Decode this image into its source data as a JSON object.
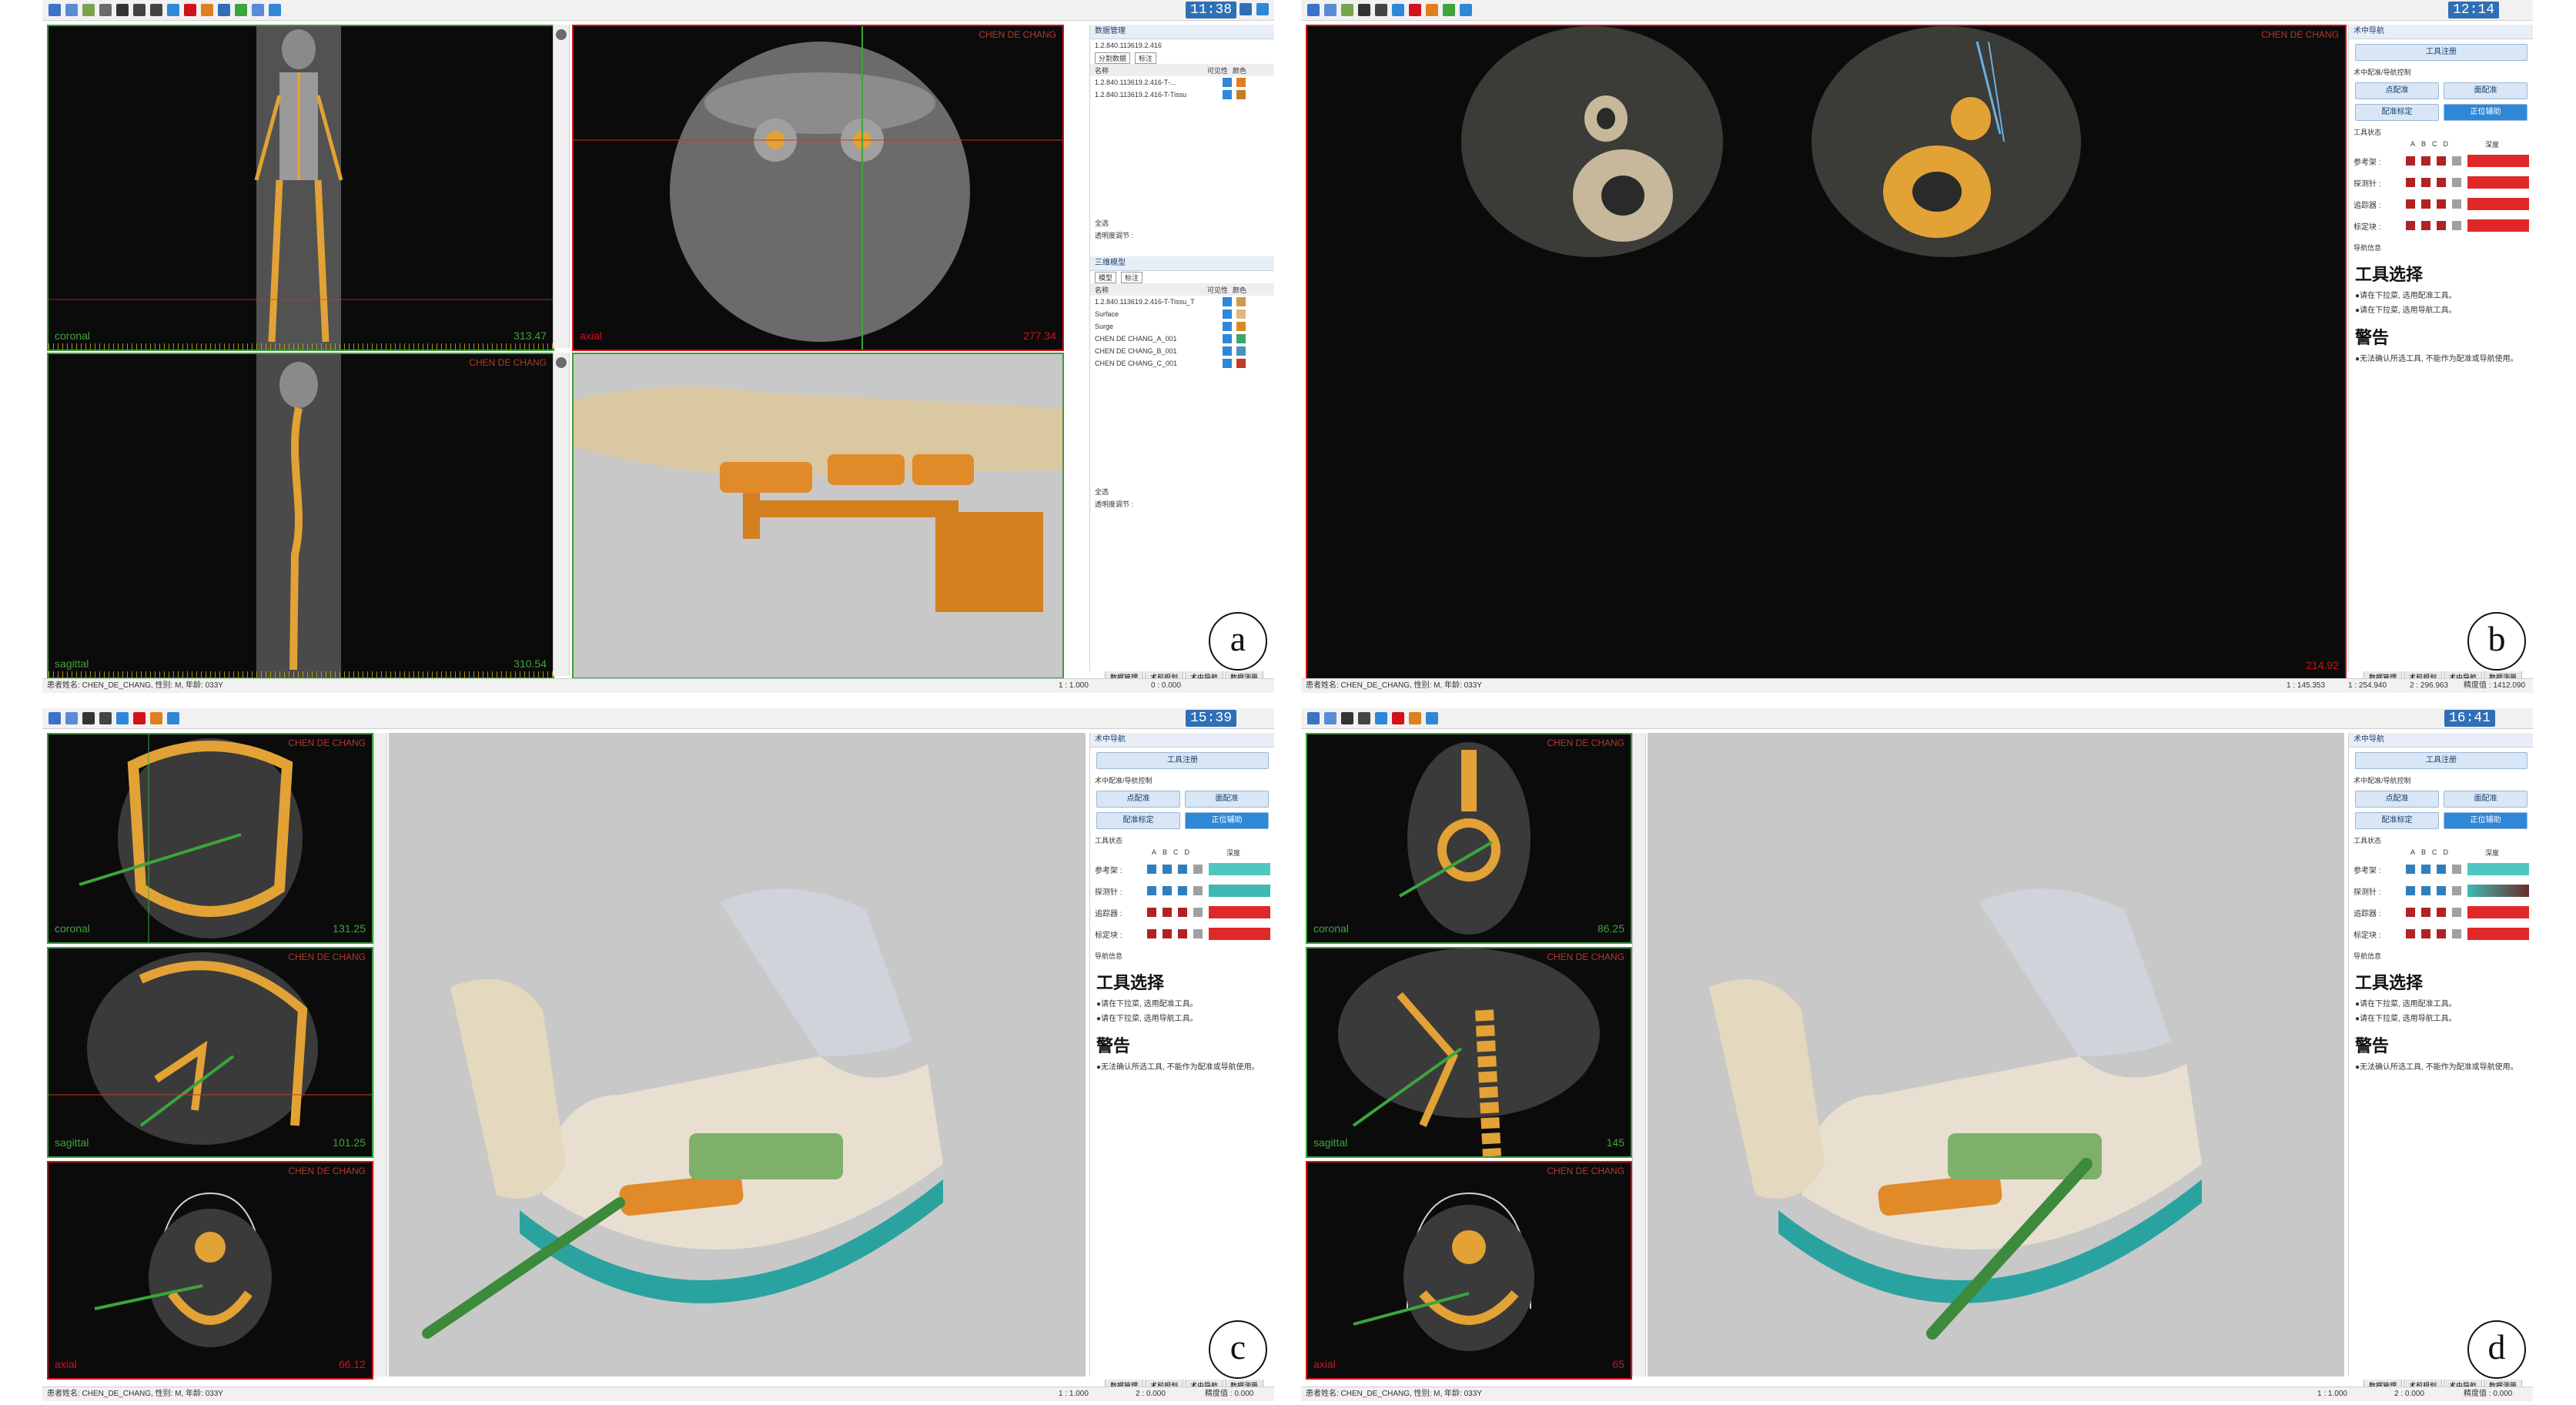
{
  "panels": {
    "a": {
      "letter": "a",
      "clock": "11:38",
      "views": {
        "coronal": {
          "label": "coronal",
          "value": "313.47",
          "name": "CHEN DE CHANG"
        },
        "axial": {
          "label": "axial",
          "value": "277.34",
          "name": "CHEN DE CHANG"
        },
        "sagittal": {
          "label": "sagittal",
          "value": "310.54",
          "name": "CHEN DE CHANG"
        }
      },
      "data_panel": {
        "title": "数据管理",
        "uid": "1.2.840.113619.2.416",
        "tabs": [
          "分割数据",
          "标注"
        ],
        "columns": [
          "名称",
          "可见性",
          "颜色"
        ],
        "rows": [
          {
            "name": "1.2.840.113619.2.416-T-...",
            "color": "#e07f1e"
          },
          {
            "name": "1.2.840.113619.2.416-T-Tissu",
            "color": "#c77b24"
          }
        ],
        "checkbox_all": "全选",
        "opacity_label": "透明度调节 :",
        "models_title": "三维模型",
        "models_tabs": [
          "模型",
          "标注"
        ],
        "models_columns": [
          "名称",
          "可见性",
          "颜色"
        ],
        "models": [
          {
            "name": "1.2.840.113619.2.416-T-Tissu_T",
            "color": "#d19a4a"
          },
          {
            "name": "Surface",
            "color": "#e0b680"
          },
          {
            "name": "Surge",
            "color": "#d88a1e"
          },
          {
            "name": "CHEN DE CHANG_A_001",
            "color": "#3aa66b"
          },
          {
            "name": "CHEN DE CHANG_B_001",
            "color": "#4a90c2"
          },
          {
            "name": "CHEN DE CHANG_C_001",
            "color": "#c0392b"
          }
        ],
        "bottom_checkbox": "全选",
        "bottom_opacity": "透明度调节 :"
      },
      "status": "患者姓名: CHEN_DE_CHANG, 性别: M, 年龄: 033Y",
      "bottom_tabs": [
        "数据管理",
        "术前规划",
        "术中导航",
        "数据测量"
      ],
      "status_right": [
        "1 : 1.000",
        "0 : 0.000"
      ]
    },
    "b": {
      "letter": "b",
      "clock": "12:14",
      "view_value": "214.92",
      "view_name": "CHEN DE CHANG",
      "nav": {
        "title": "术中导航",
        "tool_button": "工具注册",
        "section": "术中配准/导航控制",
        "buttons": [
          "点配准",
          "面配准",
          "配准标定",
          "正位辅助"
        ],
        "tool_status": "工具状态",
        "columns": [
          "A",
          "B",
          "C",
          "D",
          "深度"
        ],
        "rows": [
          {
            "name": "参考架 :",
            "colors": [
              "#b22222",
              "#b22222",
              "#b22222",
              "#a0a0a0"
            ],
            "bar": "#e02828"
          },
          {
            "name": "探测针 :",
            "colors": [
              "#b22222",
              "#b22222",
              "#b22222",
              "#a0a0a0"
            ],
            "bar": "#e02828"
          },
          {
            "name": "追踪器 :",
            "colors": [
              "#b22222",
              "#b22222",
              "#b22222",
              "#a0a0a0"
            ],
            "bar": "#e02828"
          },
          {
            "name": "标定块 :",
            "colors": [
              "#b22222",
              "#b22222",
              "#b22222",
              "#a0a0a0"
            ],
            "bar": "#e02828"
          }
        ],
        "message_title_label": "导航信息",
        "heading1": "工具选择",
        "text1a": "●请在下拉菜, 选用配准工具。",
        "text1b": "●请在下拉菜, 选用导航工具。",
        "heading2": "警告",
        "text2": "●无法确认所选工具, 不能作为配准或导航使用。"
      },
      "status": "患者姓名: CHEN_DE_CHANG, 性别: M, 年龄: 033Y",
      "bottom_tabs": [
        "数据管理",
        "术前规划",
        "术中导航",
        "数据测量"
      ],
      "status_right": [
        "1 : 254.940",
        "2 : 296.963",
        "精度值 : 1412.090",
        "1 : 145.353"
      ]
    },
    "c": {
      "letter": "c",
      "clock": "15:39",
      "views": {
        "coronal": {
          "label": "coronal",
          "value": "131.25",
          "name": "CHEN DE CHANG"
        },
        "sagittal": {
          "label": "sagittal",
          "value": "101.25",
          "name": "CHEN DE CHANG"
        },
        "axial": {
          "label": "axial",
          "value": "66.12",
          "name": "CHEN DE CHANG"
        }
      },
      "nav": {
        "title": "术中导航",
        "tool_button": "工具注册",
        "section": "术中配准/导航控制",
        "buttons": [
          "点配准",
          "面配准",
          "配准标定",
          "正位辅助"
        ],
        "tool_status": "工具状态",
        "columns": [
          "A",
          "B",
          "C",
          "D",
          "深度"
        ],
        "rows": [
          {
            "name": "参考架 :",
            "colors": [
              "#2f7fbf",
              "#2f7fbf",
              "#2f7fbf",
              "#a0a0a0"
            ],
            "bar": "#4fc7c0"
          },
          {
            "name": "探测针 :",
            "colors": [
              "#2f7fbf",
              "#2f7fbf",
              "#2f7fbf",
              "#a0a0a0"
            ],
            "bar": "#3fb8b4"
          },
          {
            "name": "追踪器 :",
            "colors": [
              "#b22222",
              "#b22222",
              "#b22222",
              "#a0a0a0"
            ],
            "bar": "#e02828"
          },
          {
            "name": "标定块 :",
            "colors": [
              "#b22222",
              "#b22222",
              "#b22222",
              "#a0a0a0"
            ],
            "bar": "#e02828"
          }
        ],
        "message_title_label": "导航信息",
        "heading1": "工具选择",
        "text1a": "●请在下拉菜, 选用配准工具。",
        "text1b": "●请在下拉菜, 选用导航工具。",
        "heading2": "警告",
        "text2": "●无法确认所选工具, 不能作为配准或导航使用。"
      },
      "status": "患者姓名: CHEN_DE_CHANG, 性别: M, 年龄: 033Y",
      "bottom_tabs": [
        "数据管理",
        "术前规划",
        "术中导航",
        "数据测量"
      ],
      "status_right": [
        "1 : 1.000",
        "2 : 0.000",
        "精度值 : 0.000"
      ]
    },
    "d": {
      "letter": "d",
      "clock": "16:41",
      "views": {
        "coronal": {
          "label": "coronal",
          "value": "86.25",
          "name": "CHEN DE CHANG"
        },
        "sagittal": {
          "label": "sagittal",
          "value": "145",
          "name": "CHEN DE CHANG"
        },
        "axial": {
          "label": "axial",
          "value": "65",
          "name": "CHEN DE CHANG"
        }
      },
      "nav": {
        "title": "术中导航",
        "tool_button": "工具注册",
        "section": "术中配准/导航控制",
        "buttons": [
          "点配准",
          "面配准",
          "配准标定",
          "正位辅助"
        ],
        "tool_status": "工具状态",
        "columns": [
          "A",
          "B",
          "C",
          "D",
          "深度"
        ],
        "rows": [
          {
            "name": "参考架 :",
            "colors": [
              "#2f7fbf",
              "#2f7fbf",
              "#2f7fbf",
              "#a0a0a0"
            ],
            "bar": "#4fc7c0"
          },
          {
            "name": "探测针 :",
            "colors": [
              "#2f7fbf",
              "#2f7fbf",
              "#2f7fbf",
              "#a0a0a0"
            ],
            "bar": "#6a2c2c"
          },
          {
            "name": "追踪器 :",
            "colors": [
              "#b22222",
              "#b22222",
              "#b22222",
              "#a0a0a0"
            ],
            "bar": "#e02828"
          },
          {
            "name": "标定块 :",
            "colors": [
              "#b22222",
              "#b22222",
              "#b22222",
              "#a0a0a0"
            ],
            "bar": "#e02828"
          }
        ],
        "message_title_label": "导航信息",
        "heading1": "工具选择",
        "text1a": "●请在下拉菜, 选用配准工具。",
        "text1b": "●请在下拉菜, 选用导航工具。",
        "heading2": "警告",
        "text2": "●无法确认所选工具, 不能作为配准或导航使用。"
      },
      "status": "患者姓名: CHEN_DE_CHANG, 性别: M, 年龄: 033Y",
      "bottom_tabs": [
        "数据管理",
        "术前规划",
        "术中导航",
        "数据测量"
      ],
      "status_right": [
        "1 : 1.000",
        "2 : 0.000",
        "精度值 : 0.000"
      ]
    }
  },
  "colors": {
    "active_view_border": "#d1121a",
    "inactive_view_border": "#3a9c3a",
    "view_label_coronal": "#3ca53c",
    "view_label_axial": "#d1121a",
    "view_label_sagittal": "#3ca53c",
    "bone": "#e3a235",
    "scene_bg": "#c8c8c8",
    "clock_bg": "#2f6fb5"
  }
}
